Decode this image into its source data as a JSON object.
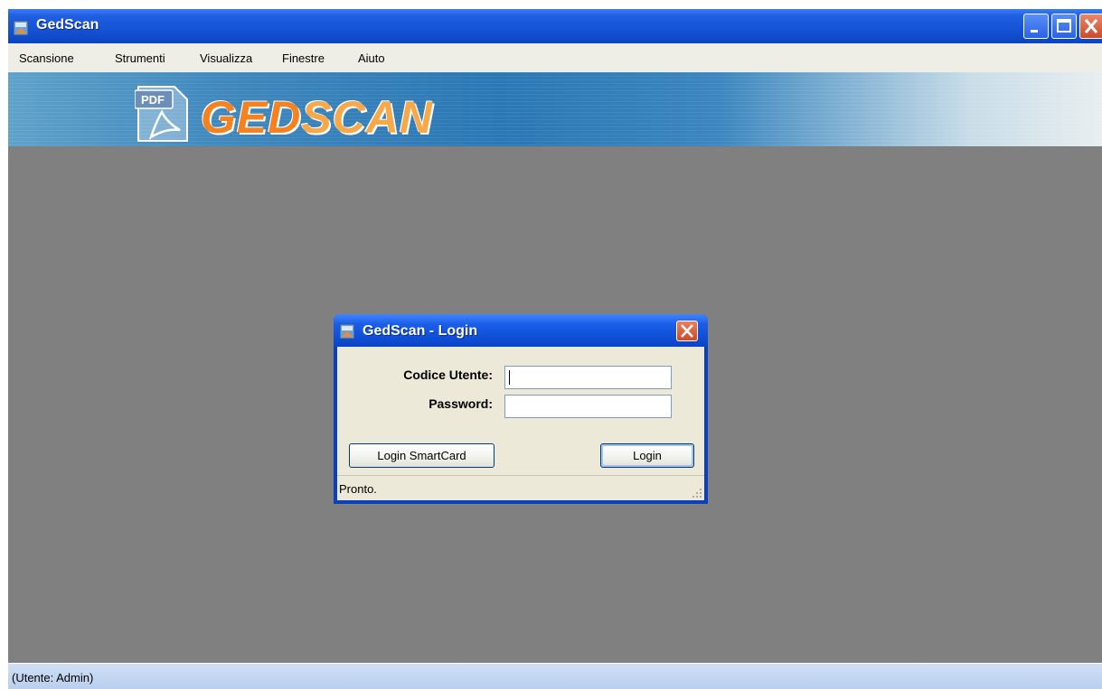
{
  "window": {
    "title": "GedScan",
    "title_bar_color": "#1652d6"
  },
  "menubar": {
    "items": [
      "Scansione",
      "Strumenti",
      "Visualizza",
      "Finestre",
      "Aiuto"
    ]
  },
  "banner": {
    "pdf_badge": "PDF",
    "logo_part1": "GED",
    "logo_part2": "SCAN",
    "logo_color": "#f5821f"
  },
  "dialog": {
    "title": "GedScan - Login",
    "user_label": "Codice Utente:",
    "user_value": "",
    "password_label": "Password:",
    "password_value": "",
    "smartcard_button": "Login SmartCard",
    "login_button": "Login",
    "status": "Pronto."
  },
  "statusbar": {
    "text": "(Utente: Admin)"
  },
  "icons": {
    "app": "gedscan-app-icon",
    "minimize": "minimize-icon",
    "maximize": "maximize-icon",
    "close": "close-icon"
  }
}
